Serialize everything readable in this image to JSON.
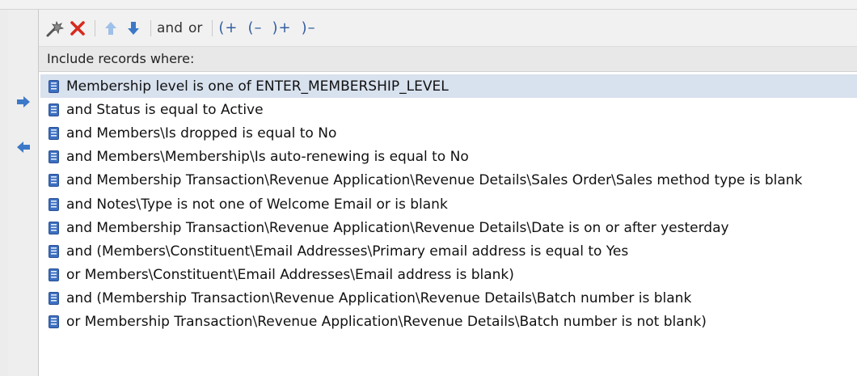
{
  "toolbar": {
    "and_label": "and",
    "or_label": "or",
    "open_paren_add": "(+",
    "open_paren_remove": "(–",
    "close_paren_add": ")+",
    "close_paren_remove": ")–"
  },
  "header": {
    "title": "Include records where:"
  },
  "criteria": [
    {
      "text": "Membership level is one of ENTER_MEMBERSHIP_LEVEL",
      "selected": true
    },
    {
      "text": "and Status is equal to Active"
    },
    {
      "text": "and Members\\Is dropped is equal to No"
    },
    {
      "text": "and Members\\Membership\\Is auto-renewing is equal to No"
    },
    {
      "text": "and Membership Transaction\\Revenue Application\\Revenue Details\\Sales Order\\Sales method type is blank"
    },
    {
      "text": "and Notes\\Type is not one of Welcome Email or is blank"
    },
    {
      "text": "and Membership Transaction\\Revenue Application\\Revenue Details\\Date is on or after yesterday"
    },
    {
      "text": "and (Members\\Constituent\\Email Addresses\\Primary email address is equal to Yes"
    },
    {
      "text": "or Members\\Constituent\\Email Addresses\\Email address is blank)"
    },
    {
      "text": "and (Membership Transaction\\Revenue Application\\Revenue Details\\Batch number is blank"
    },
    {
      "text": "or Membership Transaction\\Revenue Application\\Revenue Details\\Batch number is not blank)"
    }
  ],
  "colors": {
    "accent_blue": "#3c78c8",
    "delete_red": "#d62a1e",
    "selected_row": "#d8e1ee"
  }
}
